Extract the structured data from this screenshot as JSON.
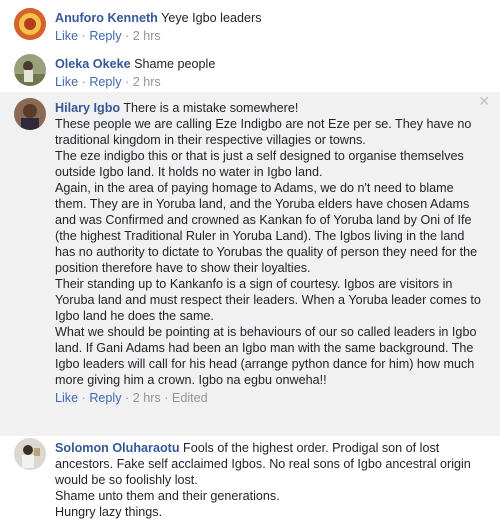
{
  "actions": {
    "like": "Like",
    "reply": "Reply",
    "dot": "·",
    "edited": "Edited"
  },
  "comments": [
    {
      "author": "Anuforo Kenneth",
      "text": "Yeye Igbo leaders",
      "time": "2 hrs"
    },
    {
      "author": "Oleka Okeke",
      "text": "Shame people",
      "time": "2 hrs"
    },
    {
      "author": "Hilary Igbo",
      "text": "There is a mistake somewhere!\nThese people we are calling Eze Indigbo are not Eze per se. They have no traditional kingdom in their respective villagies or towns.\nThe eze indigbo this or that is just a self designed to organise themselves outside Igbo land. It holds no water in Igbo land.\nAgain, in the area of paying homage to Adams, we do n't need to blame them. They are in Yoruba land, and the Yoruba elders have chosen Adams and was Confirmed and crowned as Kankan fo of Yoruba land by Oni of Ife (the highest Traditional Ruler in Yoruba Land). The Igbos living in the land has no authority to dictate to Yorubas the quality of person they need for the position therefore have to show their loyalties.\nTheir standing up to Kankanfo is a sign of courtesy. Igbos are visitors in Yoruba land and must respect their leaders. When a Yoruba leader comes to Igbo land he does the same.\nWhat we should be pointing at is behaviours of our so called leaders in Igbo land. If Gani Adams had been an Igbo man with the same background. The Igbo leaders will call for his head (arrange python dance for him) how much more giving him a crown. Igbo na egbu onweha!!",
      "time": "2 hrs"
    },
    {
      "author": "Solomon Oluharaotu",
      "text": "Fools of the highest order. Prodigal son of lost ancestors. Fake self acclaimed Igbos. No real sons of Igbo ancestral origin would be so foolishly lost.\nShame unto them and their generations.\nHungry lazy things."
    }
  ],
  "colors": {
    "author": "#365899",
    "link": "#4267b2",
    "meta": "#90949c",
    "highlight_bg": "#f1f1f1"
  },
  "icons": {
    "remove": "close-icon"
  }
}
